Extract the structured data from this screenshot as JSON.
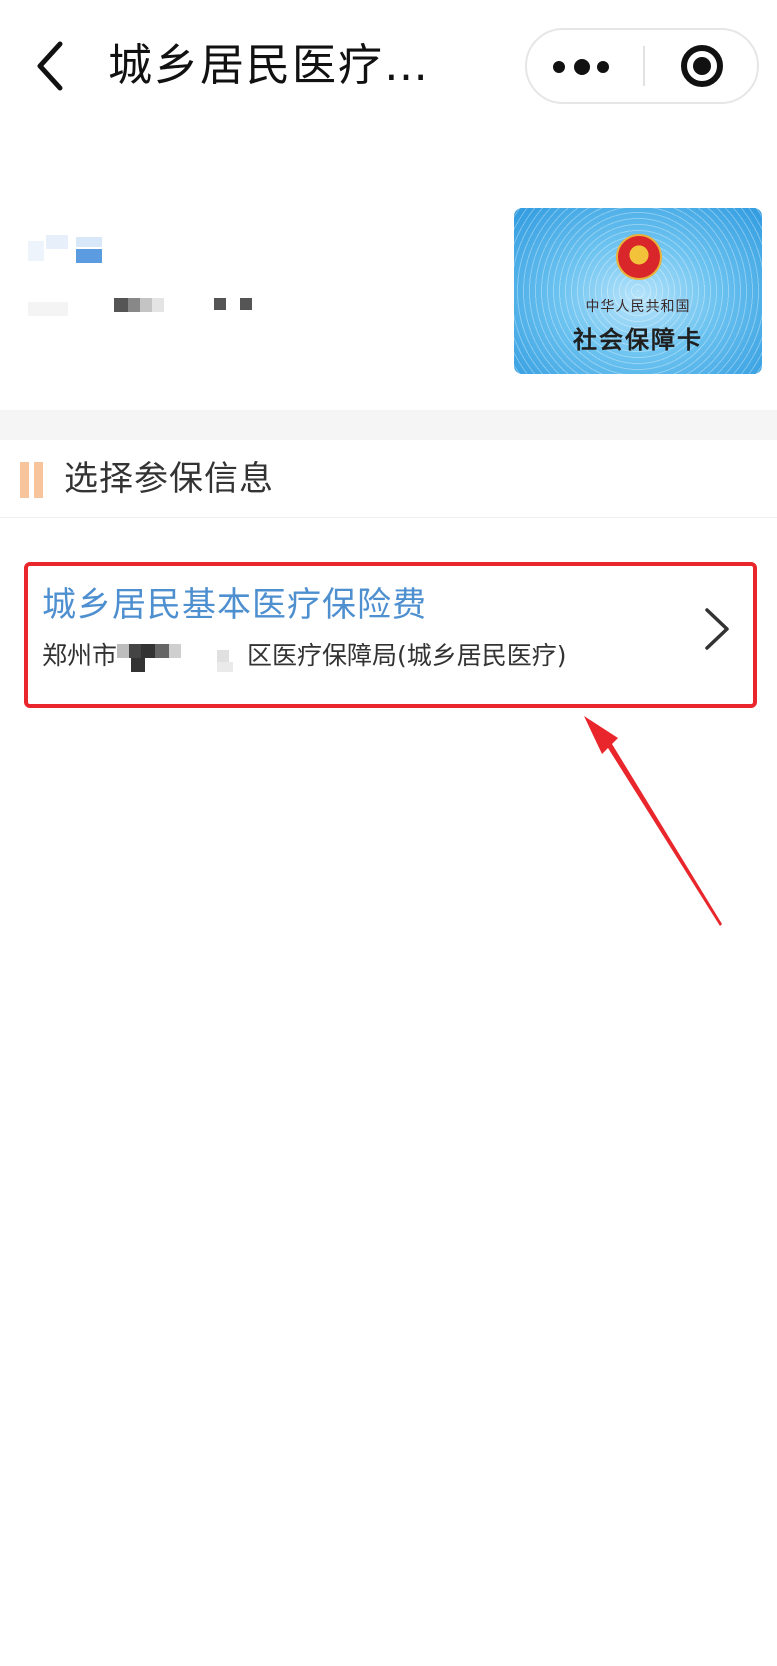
{
  "navbar": {
    "title": "城乡居民医疗…",
    "back_icon": "chevron-left-icon",
    "more_icon": "more-dots-icon",
    "close_icon": "target-close-icon"
  },
  "profile": {
    "card": {
      "top_text": "中华人民共和国",
      "main_text": "社会保障卡",
      "emblem_icon": "national-emblem-icon"
    }
  },
  "section": {
    "title": "选择参保信息",
    "accent_color": "#f7c49c"
  },
  "insurance_item": {
    "title": "城乡居民基本医疗保险费",
    "subtitle_prefix": "郑州市",
    "subtitle_suffix": "区医疗保障局(城乡居民医疗)",
    "title_color": "#4e8fd0",
    "chevron_icon": "chevron-right-icon"
  },
  "annotation": {
    "highlight_color": "#e8262b",
    "arrow_icon": "red-arrow-icon"
  }
}
